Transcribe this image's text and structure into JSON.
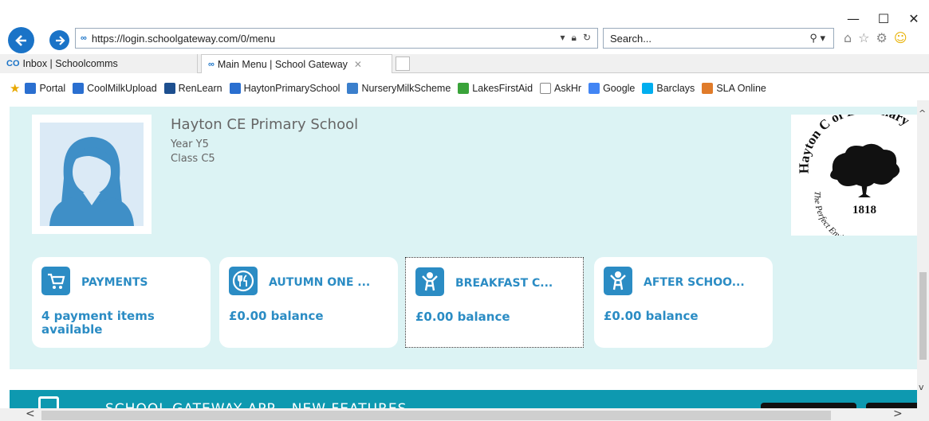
{
  "browser": {
    "url": "https://login.schoolgateway.com/0/menu",
    "search_placeholder": "Search...",
    "window_controls": [
      "—",
      "☐",
      "✕"
    ],
    "tabs": [
      {
        "label": "Inbox | Schoolcomms",
        "active": false
      },
      {
        "label": "Main Menu | School Gateway",
        "active": true
      }
    ],
    "favorites": [
      {
        "label": "Portal",
        "icon": "ie-page-icon",
        "color": "#2a6fd0"
      },
      {
        "label": "CoolMilkUpload",
        "icon": "ie-page-icon",
        "color": "#2a6fd0"
      },
      {
        "label": "RenLearn",
        "icon": "rl-icon",
        "color": "#1d4f8f"
      },
      {
        "label": "HaytonPrimarySchool",
        "icon": "ie-page-icon",
        "color": "#2a6fd0"
      },
      {
        "label": "NurseryMilkScheme",
        "icon": "milk-icon",
        "color": "#3b7fcc"
      },
      {
        "label": "LakesFirstAid",
        "icon": "green-cross-icon",
        "color": "#3aa33a"
      },
      {
        "label": "AskHr",
        "icon": "blank-page-icon",
        "color": "#ffffff"
      },
      {
        "label": "Google",
        "icon": "google-icon",
        "color": "#4285f4"
      },
      {
        "label": "Barclays",
        "icon": "barclays-eagle-icon",
        "color": "#00aeef"
      },
      {
        "label": "SLA Online",
        "icon": "sla-icon",
        "color": "#e07b2a"
      }
    ]
  },
  "student": {
    "school": "Hayton CE Primary School",
    "year": "Year Y5",
    "class": "Class C5"
  },
  "logo": {
    "top_text": "Hayton C of E Primary",
    "year": "1818",
    "motto": "The Perfect Environment for"
  },
  "tiles": [
    {
      "title": "PAYMENTS",
      "value": "4 payment items available",
      "icon": "cart-icon"
    },
    {
      "title": "AUTUMN ONE ...",
      "value": "£0.00 balance",
      "icon": "cutlery-icon"
    },
    {
      "title": "BREAKFAST C...",
      "value": "£0.00 balance",
      "icon": "children-icon"
    },
    {
      "title": "AFTER SCHOO...",
      "value": "£0.00 balance",
      "icon": "children-icon"
    }
  ],
  "banner": {
    "text": "SCHOOL GATEWAY APP - NEW FEATURES"
  },
  "colors": {
    "accent": "#2b8cc4",
    "panel_bg": "#dcf3f4",
    "banner_bg": "#0e99b0",
    "browser_blue": "#1a73c7"
  }
}
